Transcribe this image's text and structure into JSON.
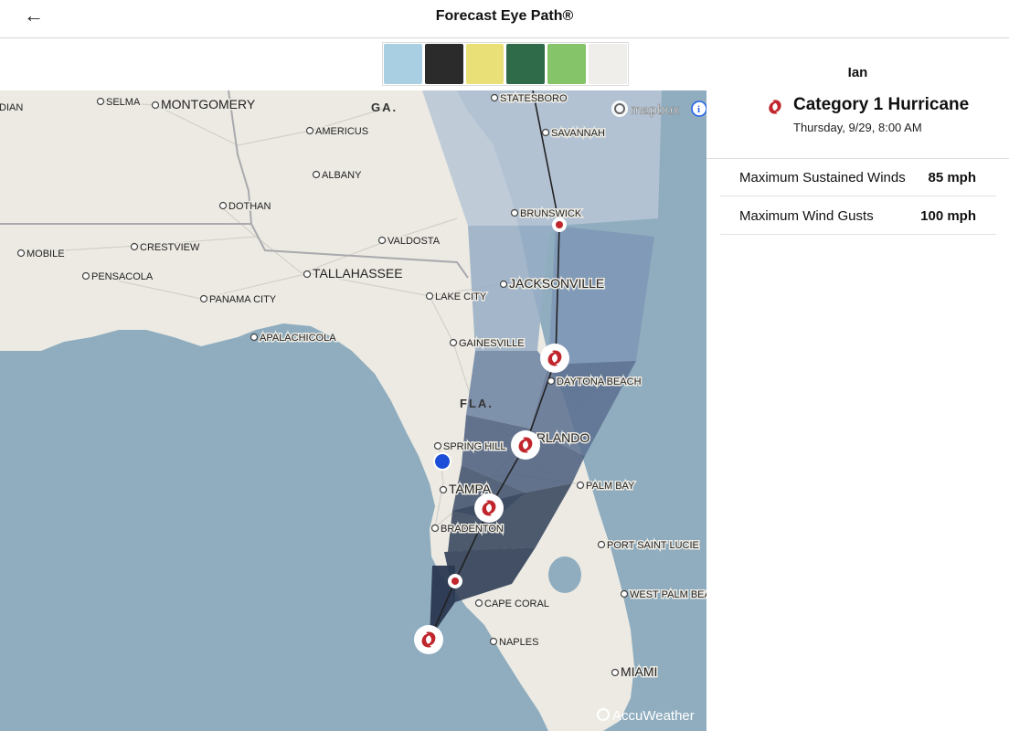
{
  "header": {
    "title": "Forecast Eye Path®",
    "back_icon": "←"
  },
  "ads": [
    {
      "color": "#a9cfe3"
    },
    {
      "color": "#2b2b2b"
    },
    {
      "color": "#e9e078"
    },
    {
      "color": "#2f6a49"
    },
    {
      "color": "#86c46a"
    },
    {
      "color": "#efeeea"
    }
  ],
  "map": {
    "states": [
      "GA.",
      "FLA."
    ],
    "cities": [
      {
        "name": "IDIAN"
      },
      {
        "name": "SELMA"
      },
      {
        "name": "MONTGOMERY"
      },
      {
        "name": "STATESBORO"
      },
      {
        "name": "SAVANNAH"
      },
      {
        "name": "AMERICUS"
      },
      {
        "name": "ALBANY"
      },
      {
        "name": "DOTHAN"
      },
      {
        "name": "BRUNSWICK"
      },
      {
        "name": "CRESTVIEW"
      },
      {
        "name": "MOBILE"
      },
      {
        "name": "VALDOSTA"
      },
      {
        "name": "PENSACOLA"
      },
      {
        "name": "TALLAHASSEE"
      },
      {
        "name": "JACKSONVILLE"
      },
      {
        "name": "PANAMA CITY"
      },
      {
        "name": "LAKE CITY"
      },
      {
        "name": "APALACHICOLA"
      },
      {
        "name": "GAINESVILLE"
      },
      {
        "name": "DAYTONA BEACH"
      },
      {
        "name": "ORLANDO"
      },
      {
        "name": "SPRING HILL"
      },
      {
        "name": "PALM BAY"
      },
      {
        "name": "TAMPA"
      },
      {
        "name": "BRADENTON"
      },
      {
        "name": "PORT SAINT LUCIE"
      },
      {
        "name": "CAPE CORAL"
      },
      {
        "name": "WEST PALM BEA"
      },
      {
        "name": "NAPLES"
      },
      {
        "name": "MIAMI"
      }
    ],
    "mapbox_label": "mapbox",
    "info_icon": "i",
    "accuweather_label": "AccuWeather",
    "colors": {
      "water": "#8fadbf",
      "land": "#eceae3",
      "cone_dark": "#33475d",
      "track": "#222222",
      "storm_red": "#c0262c",
      "user_dot": "#1d4ed8"
    }
  },
  "panel": {
    "storm_name": "Ian",
    "category": "Category 1 Hurricane",
    "time": "Thursday, 9/29, 8:00 AM",
    "hurricane_icon": "hurricane-icon",
    "stats": [
      {
        "label": "Maximum Sustained Winds",
        "value": "85 mph"
      },
      {
        "label": "Maximum Wind Gusts",
        "value": "100 mph"
      }
    ]
  }
}
